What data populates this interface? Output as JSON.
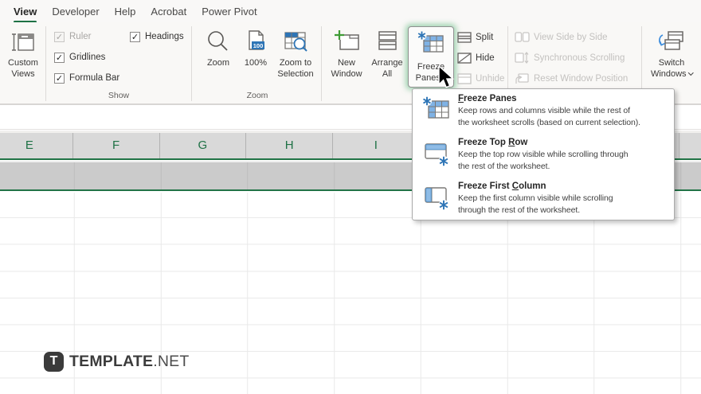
{
  "colors": {
    "excel_green": "#217346",
    "accent_blue": "#2e75b6",
    "header_gray": "#d9d9d9",
    "selection_gray": "#cbcbcb"
  },
  "tabs": [
    {
      "label": "View",
      "active": true
    },
    {
      "label": "Developer",
      "active": false
    },
    {
      "label": "Help",
      "active": false
    },
    {
      "label": "Acrobat",
      "active": false
    },
    {
      "label": "Power Pivot",
      "active": false
    }
  ],
  "ribbon": {
    "custom_views": {
      "line1": "Custom",
      "line2": "Views"
    },
    "show": {
      "group_label": "Show",
      "check_glyph": "✓",
      "items": [
        {
          "label": "Ruler",
          "checked": true,
          "disabled": true
        },
        {
          "label": "Gridlines",
          "checked": true,
          "disabled": false
        },
        {
          "label": "Formula Bar",
          "checked": true,
          "disabled": false
        },
        {
          "label": "Headings",
          "checked": true,
          "disabled": false
        }
      ]
    },
    "zoom": {
      "group_label": "Zoom",
      "zoom": "Zoom",
      "hundred": "100%",
      "hundred_badge": "100",
      "zoom_to_selection": {
        "line1": "Zoom to",
        "line2": "Selection"
      }
    },
    "window": {
      "new_window": {
        "line1": "New",
        "line2": "Window"
      },
      "arrange_all": {
        "line1": "Arrange",
        "line2": "All"
      },
      "freeze_panes": {
        "line1": "Freeze",
        "line2": "Panes"
      },
      "split": "Split",
      "hide": "Hide",
      "unhide": "Unhide",
      "view_side_by_side": "View Side by Side",
      "synchronous_scrolling": "Synchronous Scrolling",
      "reset_window_position": "Reset Window Position",
      "switch_windows": {
        "line1": "Switch",
        "line2": "Windows"
      }
    }
  },
  "menu": {
    "items": [
      {
        "title_pre": "",
        "title_key": "F",
        "title_post": "reeze Panes",
        "desc1": "Keep rows and columns visible while the rest of",
        "desc2": "the worksheet scrolls (based on current selection)."
      },
      {
        "title_pre": "Freeze Top ",
        "title_key": "R",
        "title_post": "ow",
        "desc1": "Keep the top row visible while scrolling through",
        "desc2": "the rest of the worksheet."
      },
      {
        "title_pre": "Freeze First ",
        "title_key": "C",
        "title_post": "olumn",
        "desc1": "Keep the first column visible while scrolling",
        "desc2": "through the rest of the worksheet."
      }
    ]
  },
  "sheet": {
    "columns": [
      "E",
      "F",
      "G",
      "H",
      "I"
    ]
  },
  "watermark": {
    "badge": "T",
    "brand": "TEMPLATE",
    "tld": ".NET"
  },
  "icons": [
    "custom-views-icon",
    "checkbox-check-icon",
    "magnifier-icon",
    "zoom-100-page-icon",
    "zoom-to-selection-icon",
    "new-window-icon",
    "arrange-all-icon",
    "freeze-panes-icon",
    "split-icon",
    "hide-icon",
    "unhide-icon",
    "view-side-by-side-icon",
    "synchronous-scrolling-icon",
    "reset-window-position-icon",
    "switch-windows-icon",
    "freeze-top-row-icon",
    "freeze-first-column-icon",
    "mouse-cursor-icon",
    "dropdown-chevron-icon"
  ]
}
